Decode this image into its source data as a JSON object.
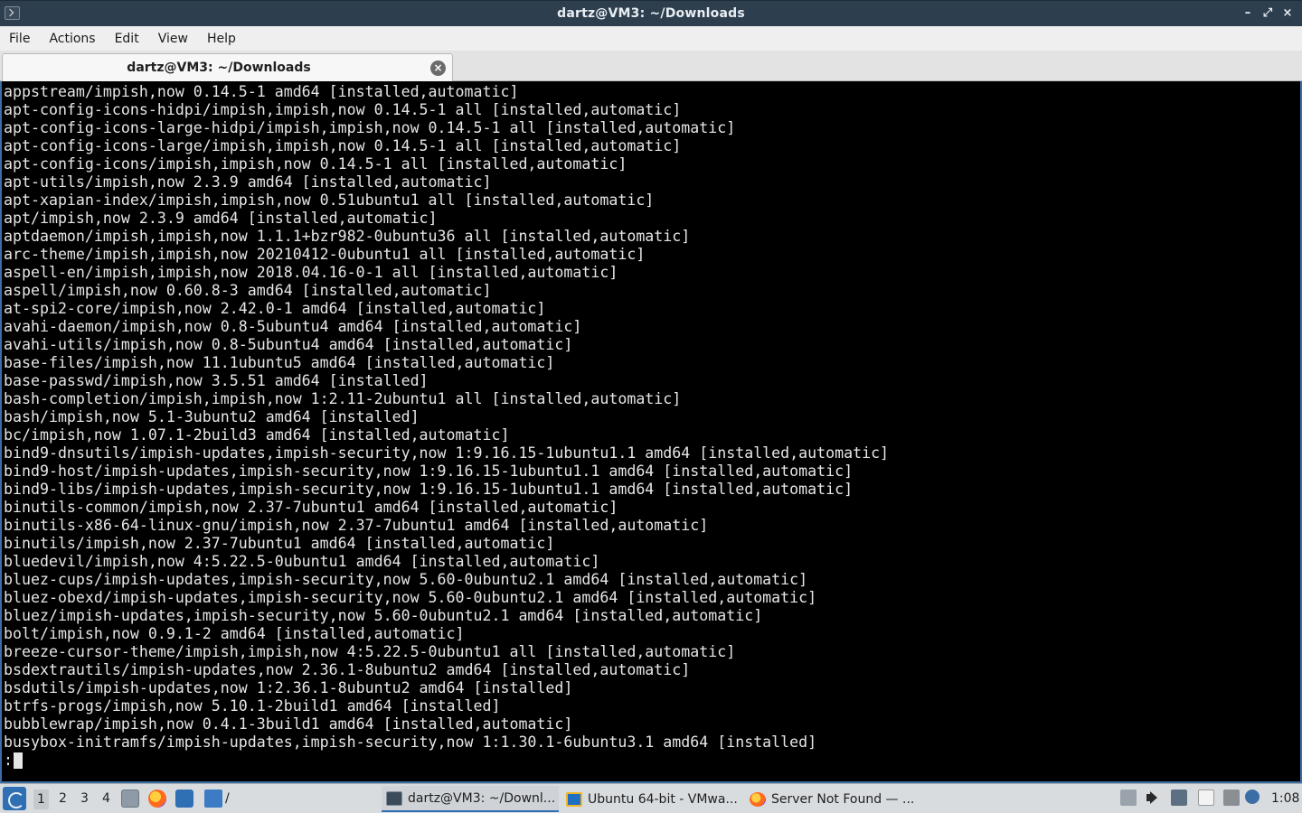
{
  "window": {
    "title": "dartz@VM3: ~/Downloads",
    "controls": {
      "minimize": "–",
      "maximize": "⤢",
      "close": "×"
    }
  },
  "menu": [
    "File",
    "Actions",
    "Edit",
    "View",
    "Help"
  ],
  "tab": {
    "label": "dartz@VM3: ~/Downloads",
    "close": "×"
  },
  "terminal": {
    "lines": [
      "appstream/impish,now 0.14.5-1 amd64 [installed,automatic]",
      "apt-config-icons-hidpi/impish,impish,now 0.14.5-1 all [installed,automatic]",
      "apt-config-icons-large-hidpi/impish,impish,now 0.14.5-1 all [installed,automatic]",
      "apt-config-icons-large/impish,impish,now 0.14.5-1 all [installed,automatic]",
      "apt-config-icons/impish,impish,now 0.14.5-1 all [installed,automatic]",
      "apt-utils/impish,now 2.3.9 amd64 [installed,automatic]",
      "apt-xapian-index/impish,impish,now 0.51ubuntu1 all [installed,automatic]",
      "apt/impish,now 2.3.9 amd64 [installed,automatic]",
      "aptdaemon/impish,impish,now 1.1.1+bzr982-0ubuntu36 all [installed,automatic]",
      "arc-theme/impish,impish,now 20210412-0ubuntu1 all [installed,automatic]",
      "aspell-en/impish,impish,now 2018.04.16-0-1 all [installed,automatic]",
      "aspell/impish,now 0.60.8-3 amd64 [installed,automatic]",
      "at-spi2-core/impish,now 2.42.0-1 amd64 [installed,automatic]",
      "avahi-daemon/impish,now 0.8-5ubuntu4 amd64 [installed,automatic]",
      "avahi-utils/impish,now 0.8-5ubuntu4 amd64 [installed,automatic]",
      "base-files/impish,now 11.1ubuntu5 amd64 [installed,automatic]",
      "base-passwd/impish,now 3.5.51 amd64 [installed]",
      "bash-completion/impish,impish,now 1:2.11-2ubuntu1 all [installed,automatic]",
      "bash/impish,now 5.1-3ubuntu2 amd64 [installed]",
      "bc/impish,now 1.07.1-2build3 amd64 [installed,automatic]",
      "bind9-dnsutils/impish-updates,impish-security,now 1:9.16.15-1ubuntu1.1 amd64 [installed,automatic]",
      "bind9-host/impish-updates,impish-security,now 1:9.16.15-1ubuntu1.1 amd64 [installed,automatic]",
      "bind9-libs/impish-updates,impish-security,now 1:9.16.15-1ubuntu1.1 amd64 [installed,automatic]",
      "binutils-common/impish,now 2.37-7ubuntu1 amd64 [installed,automatic]",
      "binutils-x86-64-linux-gnu/impish,now 2.37-7ubuntu1 amd64 [installed,automatic]",
      "binutils/impish,now 2.37-7ubuntu1 amd64 [installed,automatic]",
      "bluedevil/impish,now 4:5.22.5-0ubuntu1 amd64 [installed,automatic]",
      "bluez-cups/impish-updates,impish-security,now 5.60-0ubuntu2.1 amd64 [installed,automatic]",
      "bluez-obexd/impish-updates,impish-security,now 5.60-0ubuntu2.1 amd64 [installed,automatic]",
      "bluez/impish-updates,impish-security,now 5.60-0ubuntu2.1 amd64 [installed,automatic]",
      "bolt/impish,now 0.9.1-2 amd64 [installed,automatic]",
      "breeze-cursor-theme/impish,impish,now 4:5.22.5-0ubuntu1 all [installed,automatic]",
      "bsdextrautils/impish-updates,now 2.36.1-8ubuntu2 amd64 [installed,automatic]",
      "bsdutils/impish-updates,now 1:2.36.1-8ubuntu2 amd64 [installed]",
      "btrfs-progs/impish,now 5.10.1-2build1 amd64 [installed]",
      "bubblewrap/impish,now 0.4.1-3build1 amd64 [installed,automatic]",
      "busybox-initramfs/impish-updates,impish-security,now 1:1.30.1-6ubuntu3.1 amd64 [installed]"
    ],
    "prompt": ":"
  },
  "taskbar": {
    "workspaces": [
      "1",
      "2",
      "3",
      "4"
    ],
    "path_label": "/",
    "tasks": [
      {
        "label": "dartz@VM3: ~/Downl...",
        "icon": "terminal-icon"
      },
      {
        "label": "Ubuntu 64-bit - VMwa...",
        "icon": "vmware-icon"
      },
      {
        "label": "Server Not Found — ...",
        "icon": "firefox-icon"
      }
    ],
    "clock": "1:08"
  },
  "colors": {
    "titlebar": "#2d3e4f",
    "terminal_bg": "#000000",
    "terminal_fg": "#e6e6e6",
    "accent": "#3b6ea5",
    "taskbar": "#d9dcdf"
  }
}
